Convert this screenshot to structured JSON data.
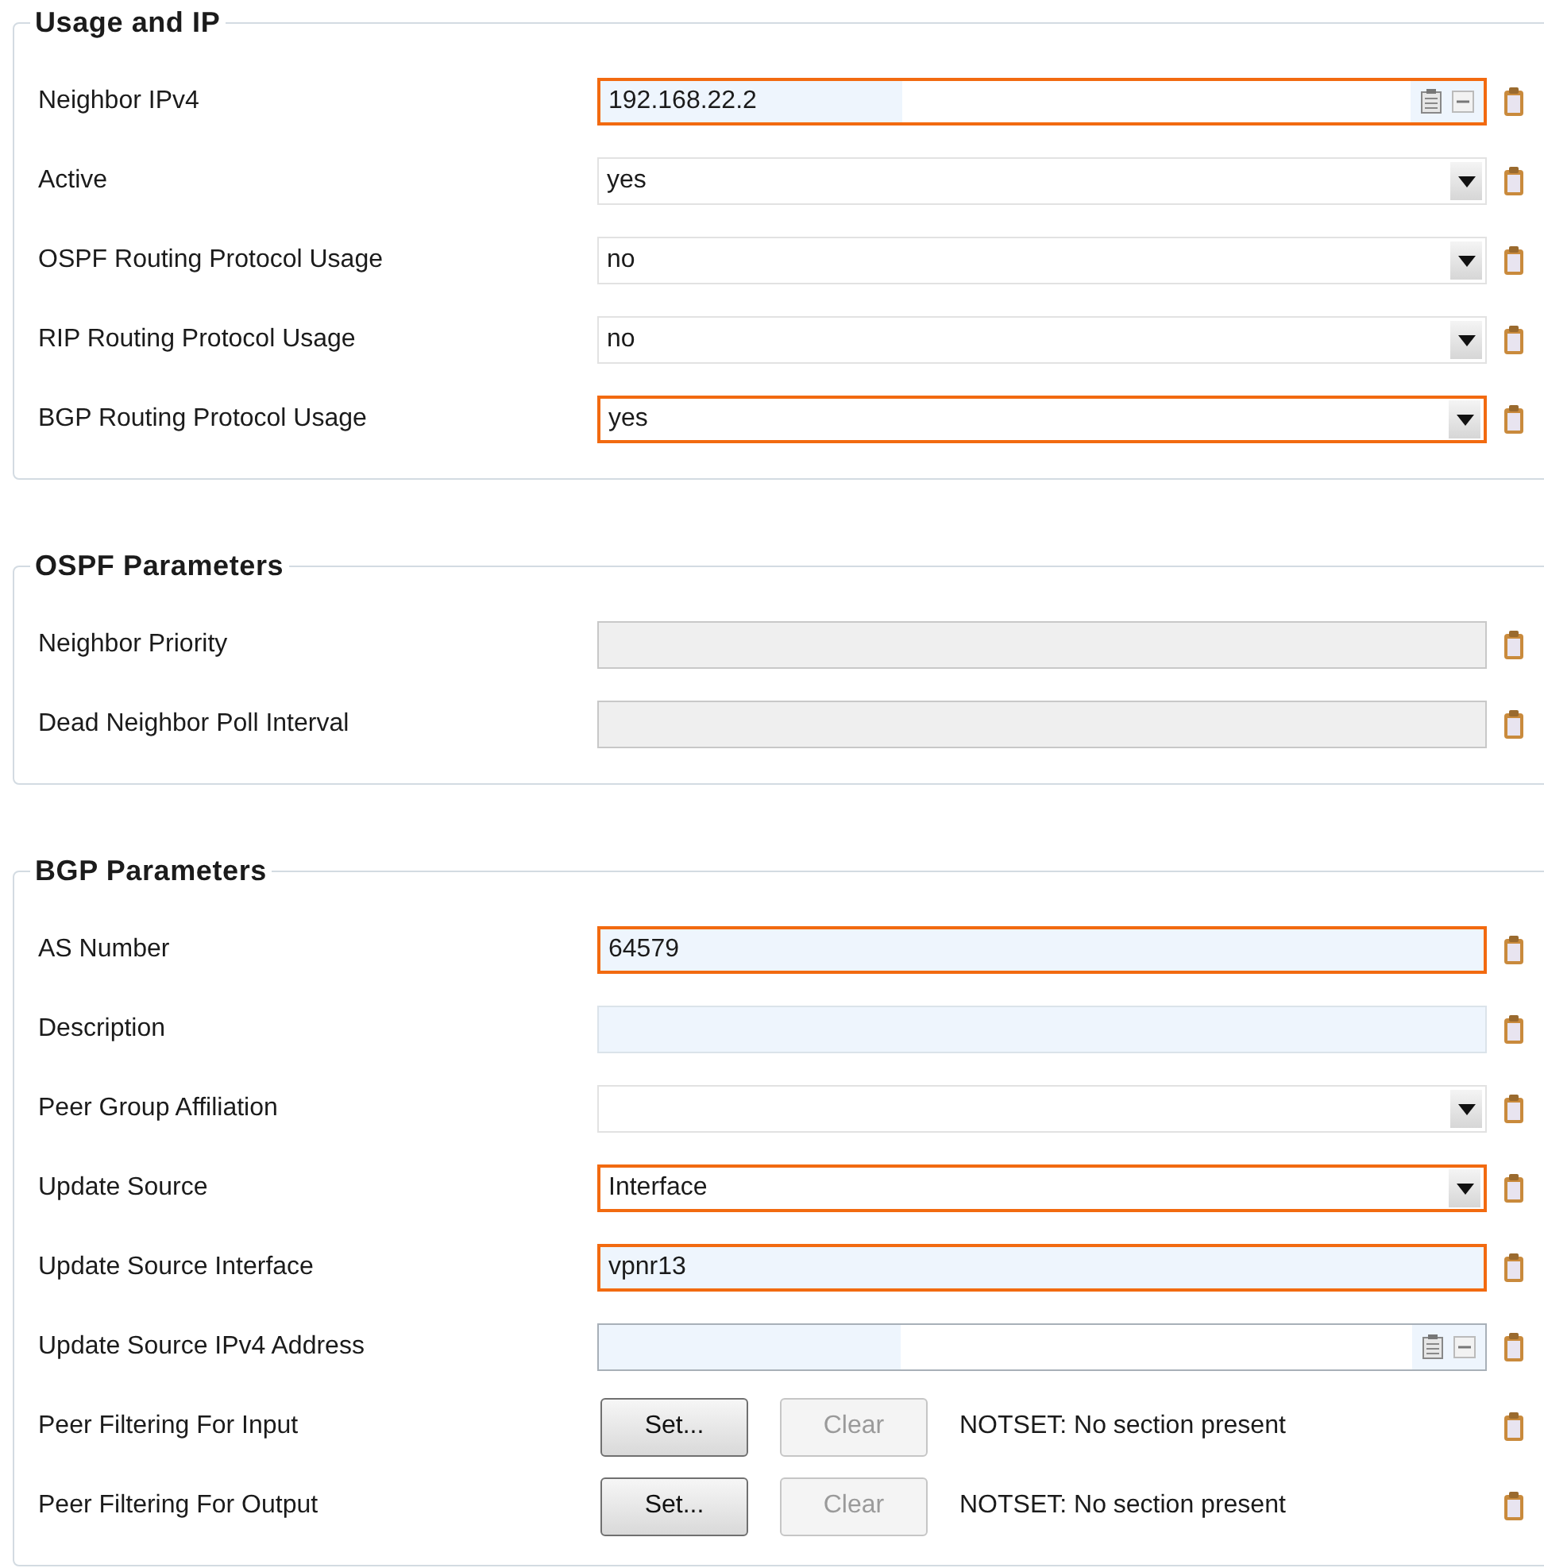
{
  "sections": [
    {
      "title": "Usage and IP",
      "rows": [
        {
          "label": "Neighbor IPv4",
          "kind": "ip",
          "value": "192.168.22.2",
          "modified": true
        },
        {
          "label": "Active",
          "kind": "select",
          "value": "yes",
          "modified": false
        },
        {
          "label": "OSPF Routing Protocol Usage",
          "kind": "select",
          "value": "no",
          "modified": false
        },
        {
          "label": "RIP Routing Protocol Usage",
          "kind": "select",
          "value": "no",
          "modified": false
        },
        {
          "label": "BGP Routing Protocol Usage",
          "kind": "select",
          "value": "yes",
          "modified": true
        }
      ]
    },
    {
      "title": "OSPF Parameters",
      "rows": [
        {
          "label": "Neighbor Priority",
          "kind": "text",
          "disabled": true,
          "modified": false
        },
        {
          "label": "Dead Neighbor Poll Interval",
          "kind": "text",
          "disabled": true,
          "modified": false
        }
      ]
    },
    {
      "title": "BGP Parameters",
      "rows": [
        {
          "label": "AS Number",
          "kind": "text",
          "value": "64579",
          "disabled": false,
          "modified": true
        },
        {
          "label": "Description",
          "kind": "text",
          "disabled": false,
          "modified": false
        },
        {
          "label": "Peer Group Affiliation",
          "kind": "select",
          "modified": false
        },
        {
          "label": "Update Source",
          "kind": "select",
          "value": "Interface",
          "modified": true
        },
        {
          "label": "Update Source Interface",
          "kind": "text",
          "value": "vpnr13",
          "disabled": false,
          "modified": true
        },
        {
          "label": "Update Source IPv4 Address",
          "kind": "ip",
          "modified": false
        },
        {
          "label": "Peer Filtering For Input",
          "kind": "buttons",
          "buttons": [
            {
              "label": "Set...",
              "disabled": false
            },
            {
              "label": "Clear",
              "disabled": true
            }
          ],
          "status": "NOTSET: No section present"
        },
        {
          "label": "Peer Filtering For Output",
          "kind": "buttons",
          "buttons": [
            {
              "label": "Set...",
              "disabled": false
            },
            {
              "label": "Clear",
              "disabled": true
            }
          ],
          "status": "NOTSET: No section present"
        }
      ]
    }
  ]
}
